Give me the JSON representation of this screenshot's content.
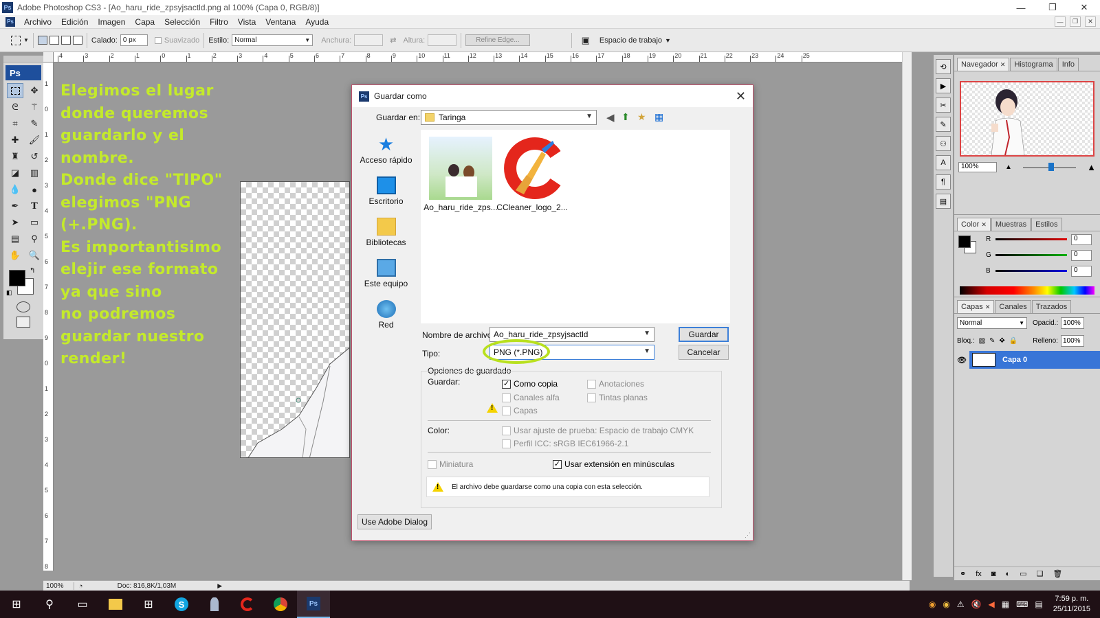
{
  "window": {
    "title": "Adobe Photoshop CS3 - [Ao_haru_ride_zpsyjsactld.png al 100% (Capa 0, RGB/8)]",
    "app_icon": "Ps",
    "controls": [
      "—",
      "❐",
      "✕"
    ]
  },
  "menu": [
    "Archivo",
    "Edición",
    "Imagen",
    "Capa",
    "Selección",
    "Filtro",
    "Vista",
    "Ventana",
    "Ayuda"
  ],
  "options": {
    "calado_label": "Calado:",
    "calado_value": "0 px",
    "suavizado_label": "Suavizado",
    "estilo_label": "Estilo:",
    "estilo_value": "Normal",
    "anchura_label": "Anchura:",
    "altura_label": "Altura:",
    "refine_label": "Refine Edge...",
    "workspace_label": "Espacio de trabajo"
  },
  "toolbox": {
    "badge": "Ps"
  },
  "ruler": {
    "top": [
      "4",
      "3",
      "2",
      "1",
      "0",
      "1",
      "2",
      "3",
      "4",
      "5",
      "6",
      "7",
      "8",
      "9",
      "10",
      "11",
      "12",
      "13",
      "14",
      "15",
      "16",
      "17",
      "18",
      "19",
      "20",
      "21",
      "22",
      "23",
      "24",
      "25"
    ],
    "left": [
      "1",
      "0",
      "1",
      "2",
      "3",
      "4",
      "5",
      "6",
      "7",
      "8",
      "9",
      "0",
      "1",
      "2",
      "3",
      "4",
      "5",
      "6",
      "7",
      "8",
      "9"
    ]
  },
  "instruction": {
    "lines": [
      "Elegimos el lugar",
      "donde queremos",
      "guardarlo y el",
      "nombre.",
      "Donde dice \"TIPO\"",
      "elegimos \"PNG",
      "(+.PNG).",
      "Es importantisimo",
      "elejir ese formato",
      "ya que sino",
      "no podremos",
      "guardar nuestro",
      "render!"
    ],
    "color": "#c4ea2b"
  },
  "status": {
    "zoom": "100%",
    "doc": "Doc: 816,8K/1,03M"
  },
  "navigator": {
    "tabs": [
      "Navegador",
      "Histograma",
      "Info"
    ],
    "zoom": "100%"
  },
  "color_panel": {
    "tabs": [
      "Color",
      "Muestras",
      "Estilos"
    ],
    "channels": [
      {
        "label": "R",
        "value": "0",
        "color": "#e00000"
      },
      {
        "label": "G",
        "value": "0",
        "color": "#00b000"
      },
      {
        "label": "B",
        "value": "0",
        "color": "#0000e0"
      }
    ]
  },
  "layers_panel": {
    "tabs": [
      "Capas",
      "Canales",
      "Trazados"
    ],
    "blend_mode": "Normal",
    "opacity_label": "Opacid.:",
    "opacity_value": "100%",
    "lock_label": "Bloq.:",
    "fill_label": "Relleno:",
    "fill_value": "100%",
    "layer_name": "Capa 0"
  },
  "dialog": {
    "title": "Guardar como",
    "save_in_label": "Guardar en:",
    "save_in_value": "Taringa",
    "places": [
      "Acceso rápido",
      "Escritorio",
      "Bibliotecas",
      "Este equipo",
      "Red"
    ],
    "files": [
      "Ao_haru_ride_zps...",
      "CCleaner_logo_2..."
    ],
    "filename_label": "Nombre de archivo:",
    "filename_value": "Ao_haru_ride_zpsyjsactld",
    "type_label": "Tipo:",
    "type_value": "PNG (*.PNG)",
    "save_button": "Guardar",
    "cancel_button": "Cancelar",
    "options_title": "Opciones de guardado",
    "save_group_label": "Guardar:",
    "options": {
      "como_copia": "Como copia",
      "anotaciones": "Anotaciones",
      "canales_alfa": "Canales alfa",
      "tintas_planas": "Tintas planas",
      "capas": "Capas"
    },
    "color_label": "Color:",
    "color_options": {
      "prueba": "Usar ajuste de prueba: Espacio de trabajo CMYK",
      "icc": "Perfil ICC: sRGB IEC61966-2.1"
    },
    "miniatura": "Miniatura",
    "extension": "Usar extensión en minúsculas",
    "warning": "El archivo debe guardarse como una copia con esta selección.",
    "adobe_dialog_button": "Use Adobe Dialog",
    "highlight_color": "#b8e01e"
  },
  "taskbar": {
    "clock_time": "7:59 p. m.",
    "clock_date": "25/11/2015"
  }
}
